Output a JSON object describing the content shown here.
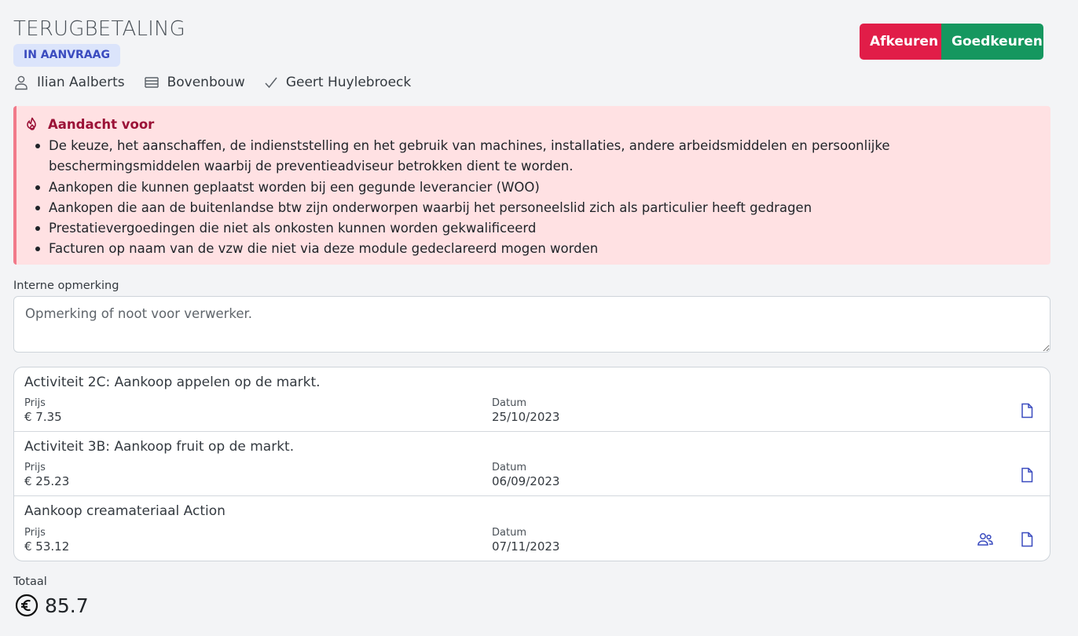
{
  "header": {
    "title": "TERUGBETALING",
    "status": "IN AANVRAAG",
    "meta": {
      "person": "Ilian Aalberts",
      "group": "Bovenbouw",
      "approver": "Geert Huylebroeck"
    },
    "actions": {
      "reject_label": "Afkeuren",
      "approve_label": "Goedkeuren"
    }
  },
  "alert": {
    "title": "Aandacht voor",
    "items": [
      "De keuze, het aanschaffen, de indienststelling en het gebruik van machines, installaties, andere arbeidsmiddelen en persoonlijke beschermingsmiddelen waarbij de preventieadviseur betrokken dient te worden.",
      "Aankopen die kunnen geplaatst worden bij een gegunde leverancier (WOO)",
      "Aankopen die aan de buitenlandse btw zijn onderworpen waarbij het personeelslid zich als particulier heeft gedragen",
      "Prestatievergoedingen die niet als onkosten kunnen worden gekwalificeerd",
      "Facturen op naam van de vzw die niet via deze module gedeclareerd mogen worden"
    ]
  },
  "remark": {
    "label": "Interne opmerking",
    "placeholder": "Opmerking of noot voor verwerker.",
    "value": ""
  },
  "expenses": {
    "price_label": "Prijs",
    "date_label": "Datum",
    "items": [
      {
        "title": "Activiteit 2C: Aankoop appelen op de markt.",
        "price": "€ 7.35",
        "date": "25/10/2023"
      },
      {
        "title": "Activiteit 3B: Aankoop fruit op de markt.",
        "price": "€ 25.23",
        "date": "06/09/2023"
      },
      {
        "title": "Aankoop creamateriaal Action",
        "price": "€ 53.12",
        "date": "07/11/2023"
      }
    ]
  },
  "total": {
    "label": "Totaal",
    "value": "85.7"
  },
  "colors": {
    "reject": "#e11d48",
    "approve": "#15975f",
    "alert_bg": "#ffe1e3",
    "alert_title": "#9b1237",
    "icon_accent": "#3a4bbf",
    "badge_bg": "#dbe4fb"
  },
  "icons": [
    "user-icon",
    "layers-icon",
    "check-icon",
    "fire-icon",
    "document-icon",
    "people-icon",
    "euro-circle-icon"
  ]
}
